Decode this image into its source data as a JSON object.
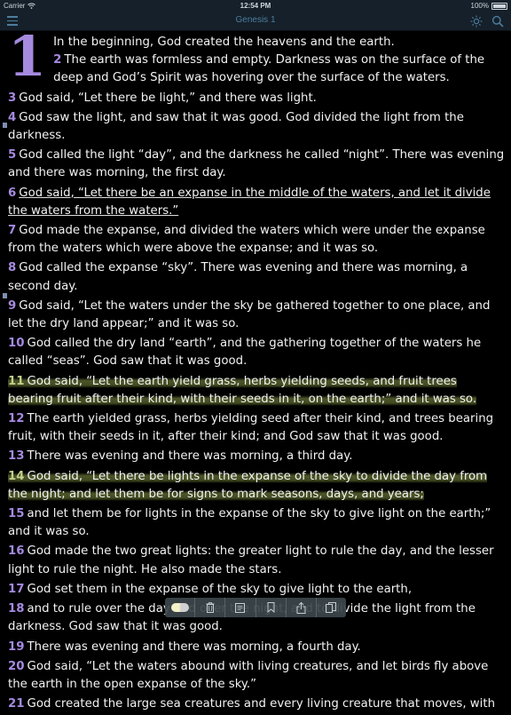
{
  "status_bar": {
    "carrier": "Carrier",
    "time": "12:54 PM",
    "battery": "100%"
  },
  "nav": {
    "title": "Genesis 1",
    "menu_icon": "hamburger-icon",
    "brightness_icon": "sun-icon",
    "search_icon": "search-icon"
  },
  "chapter": {
    "number": "1",
    "verses": [
      {
        "n": "",
        "text": "In the beginning, God created the heavens and the earth."
      },
      {
        "n": "2",
        "text": "The earth was formless and empty. Darkness was on the surface of the deep and God’s Spirit was hovering over the surface of the waters."
      },
      {
        "n": "3",
        "text": "God said, “Let there be light,” and there was light."
      },
      {
        "n": "4",
        "text": "God saw the light, and saw that it was good. God divided the light from the darkness."
      },
      {
        "n": "5",
        "text": "God called the light “day”, and the darkness he called “night”. There was evening and there was morning, the first day."
      },
      {
        "n": "6",
        "text": "God said, “Let there be an expanse in the middle of the waters, and let it divide the waters from the waters.”"
      },
      {
        "n": "7",
        "text": "God made the expanse, and divided the waters which were under the expanse from the waters which were above the expanse; and it was so."
      },
      {
        "n": "8",
        "text": "God called the expanse “sky”. There was evening and there was morning, a second day."
      },
      {
        "n": "9",
        "text": "God said, “Let the waters under the sky be gathered together to one place, and let the dry land appear;” and it was so."
      },
      {
        "n": "10",
        "text": "God called the dry land “earth”, and the gathering together of the waters he called “seas”. God saw that it was good."
      },
      {
        "n": "11",
        "text": "God said, “Let the earth yield grass, herbs yielding seeds, and fruit trees bearing fruit after their kind, with their seeds in it, on the earth;” and it was so."
      },
      {
        "n": "12",
        "text": "The earth yielded grass, herbs yielding seed after their kind, and trees bearing fruit, with their seeds in it, after their kind; and God saw that it was good."
      },
      {
        "n": "13",
        "text": "There was evening and there was morning, a third day."
      },
      {
        "n": "14",
        "text": "God said, “Let there be lights in the expanse of the sky to divide the day from the night; and let them be for signs to mark seasons, days, and years;"
      },
      {
        "n": "15",
        "text": "and let them be for lights in the expanse of the sky to give light on the earth;” and it was so."
      },
      {
        "n": "16",
        "text": "God made the two great lights: the greater light to rule the day, and the lesser light to rule the night. He also made the stars."
      },
      {
        "n": "17",
        "text": "God set them in the expanse of the sky to give light to the earth,"
      },
      {
        "n": "18",
        "text": "and to rule over the day and over the night, and to divide the light from the darkness. God saw that it was good."
      },
      {
        "n": "19",
        "text": "There was evening and there was morning, a fourth day."
      },
      {
        "n": "20",
        "text": "God said, “Let the waters abound with living creatures, and let birds fly above the earth in the open expanse of the sky.”"
      },
      {
        "n": "21",
        "text": "God created the large sea creatures and every living creature that moves, with"
      }
    ]
  },
  "toolbar": {
    "buttons": [
      "highlight-toggle",
      "trash-icon",
      "note-icon",
      "bookmark-icon",
      "share-icon",
      "copy-icon"
    ]
  }
}
